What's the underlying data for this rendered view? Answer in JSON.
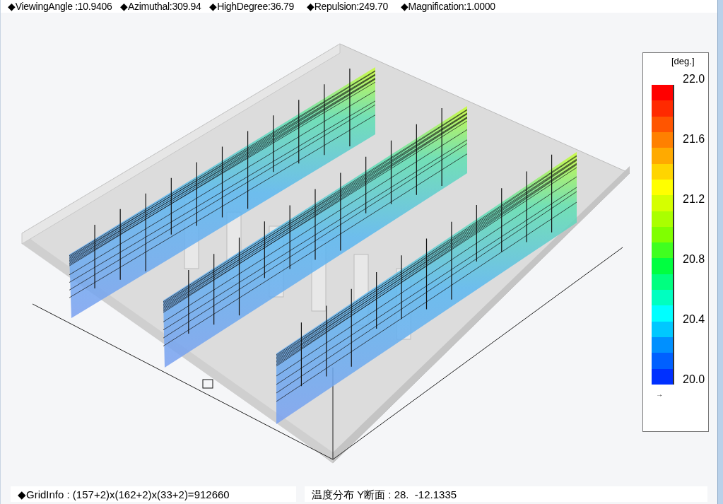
{
  "view_info": [
    "◆ViewingAngle :10.9406",
    "◆Azimuthal:309.94",
    "◆HighDegree:36.79",
    "◆Repulsion:249.70",
    "◆Magnification:1.0000"
  ],
  "legend": {
    "unit": "[deg.]",
    "ticks": [
      "22.0",
      "21.6",
      "21.2",
      "20.8",
      "20.4",
      "20.0"
    ],
    "marker": "→",
    "swatches": [
      {
        "color": "#ff0000"
      },
      {
        "color": "#ff2a00"
      },
      {
        "color": "#ff5500"
      },
      {
        "color": "#ff8000"
      },
      {
        "color": "#ffaa00"
      },
      {
        "color": "#ffd500"
      },
      {
        "color": "#ffff00"
      },
      {
        "color": "#d5ff00"
      },
      {
        "color": "#aaff00"
      },
      {
        "color": "#80ff00"
      },
      {
        "color": "#40ff20"
      },
      {
        "color": "#00ff40"
      },
      {
        "color": "#00ff80"
      },
      {
        "color": "#00ffc0"
      },
      {
        "color": "#00ffff"
      },
      {
        "color": "#00c8ff"
      },
      {
        "color": "#0090ff"
      },
      {
        "color": "#0060ff"
      },
      {
        "color": "#0030ff"
      }
    ]
  },
  "status": {
    "grid_info": "◆GridInfo : (157+2)x(162+2)x(33+2)=912660",
    "section": "温度分布 Y断面 : 28.  -12.1335"
  }
}
